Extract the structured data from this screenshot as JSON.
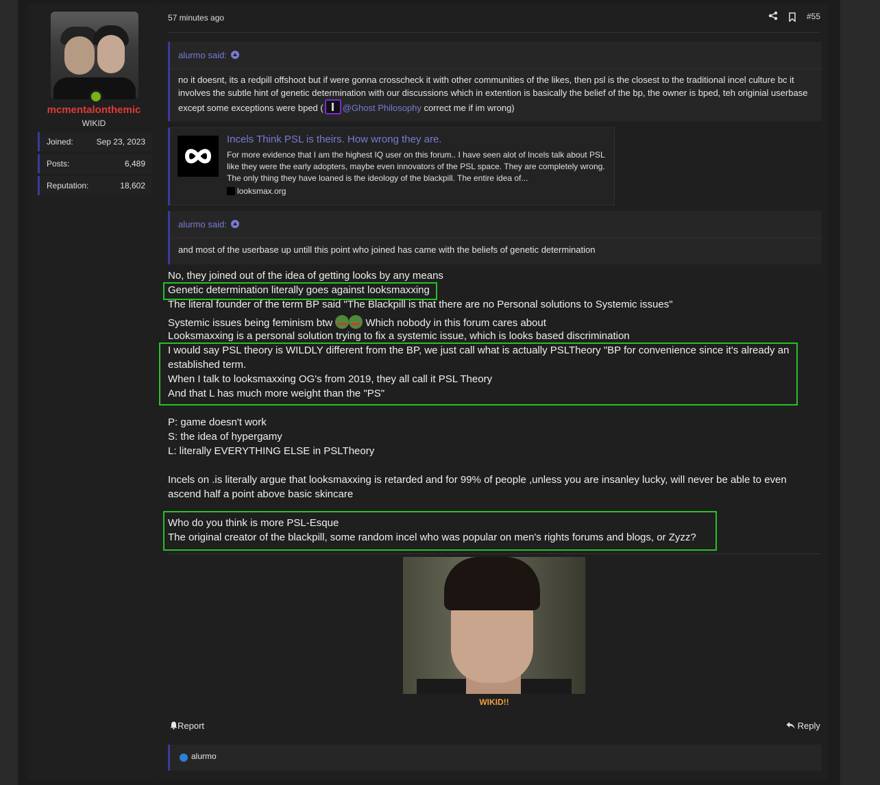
{
  "user": {
    "name": "mcmentalonthemic",
    "title": "WIKID",
    "stats": [
      {
        "label": "Joined:",
        "value": "Sep 23, 2023"
      },
      {
        "label": "Posts:",
        "value": "6,489"
      },
      {
        "label": "Reputation:",
        "value": "18,602"
      }
    ]
  },
  "post": {
    "time": "57 minutes ago",
    "number": "#55",
    "quote1": {
      "author": "alurmo said:",
      "text_before": "no it doesnt, its a redpill offshoot but if were gonna crosscheck it with other communities of the likes, then psl is the closest to the traditional incel culture bc it involves the subtle hint of genetic determination with our discussions which in extention is basically the belief of the bp, the owner is bped, teh originial userbase except some exceptions were bped (",
      "mention": "@Ghost Philosophy",
      "text_after": " correct me if im wrong)"
    },
    "embed": {
      "title": "Incels Think PSL is theirs. How wrong they are.",
      "description": "For more evidence that I am the highest IQ user on this forum.. I have seen alot of Incels talk about PSL like they were the early adopters, maybe even innovators of the PSL space. They are completely wrong. The only thing they have loaned is the ideology of the blackpill. The entire idea of...",
      "site": "looksmax.org"
    },
    "quote2": {
      "author": "alurmo said:",
      "text": "and most of the userbase up untill this point who joined has came with the beliefs of genetic determination"
    },
    "lines": [
      "No, they joined out of the idea of getting looks by any means",
      "Genetic determination literally goes against looksmaxxing",
      "The literal founder of the term BP said \"The Blackpill is that there are no Personal solutions to Systemic issues\"",
      "Systemic issues being feminism btw",
      " Which nobody in this forum cares about",
      "Looksmaxxing is a personal solution trying to fix a systemic issue, which is looks based discrimination",
      "I would say PSL theory is WILDLY different from the BP, we just call what is actually PSLTheory \"BP for convenience since it's already an",
      "established term.",
      "When I talk to looksmaxxing OG's from 2019, they all call it PSL Theory",
      "And that L has much more weight than the \"PS\"",
      "P: game doesn't work",
      "S: the idea of hypergamy",
      "L: literally EVERYTHING ELSE in PSLTheory",
      "Incels on .is literally argue that looksmaxxing is retarded and for 99% of people ,unless you are insanley lucky, will never be able to even",
      "ascend half a point above basic skincare",
      "Who do you think is more PSL-Esque",
      "The original creator of the blackpill, some random incel who was popular on men's rights forums and blogs, or Zyzz?"
    ],
    "image_caption": "WIKID!!",
    "report_label": "Report",
    "reply_label": "Reply",
    "reactions_by": "alurmo"
  },
  "colors": {
    "accent": "#7a7ad6",
    "username": "#e03a3a",
    "highlight_box": "#26c226",
    "caption": "#f0a040"
  },
  "icons": [
    "share-icon",
    "bookmark-icon",
    "quote-arrow-icon",
    "bell-icon",
    "reply-icon",
    "like-icon",
    "online-icon"
  ]
}
